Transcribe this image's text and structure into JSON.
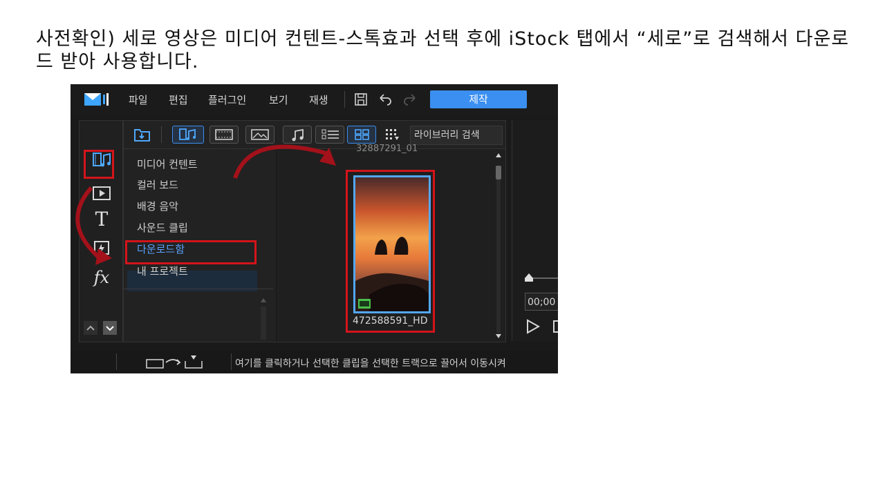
{
  "caption": "사전확인) 세로 영상은 미디어 컨텐트-스톡효과 선택 후에 iStock 탭에서 “세로”로 검색해서 다운로드 받아 사용합니다.",
  "menu": {
    "items": [
      "파일",
      "편집",
      "플러그인",
      "보기",
      "재생"
    ],
    "produce_label": "제작"
  },
  "library": {
    "search_placeholder": "라이브러리 검색",
    "categories": [
      "미디어 컨텐트",
      "컬러 보드",
      "배경 음악",
      "사운드 클립",
      "다운로드함",
      "내 프로젝트"
    ],
    "active_category": "다운로드함",
    "top_partial_label": "32887291_01",
    "thumbnail_label": "472588591_HD"
  },
  "status": {
    "hint_text": "여기를 클릭하거나 선택한 클립을 선택한 트랙으로 끌어서 이동시켜"
  },
  "preview": {
    "timecode": "00;00"
  },
  "colors": {
    "accent": "#3b8ff0",
    "highlight_red": "#d4141b",
    "selected_text": "#59a3ff"
  }
}
